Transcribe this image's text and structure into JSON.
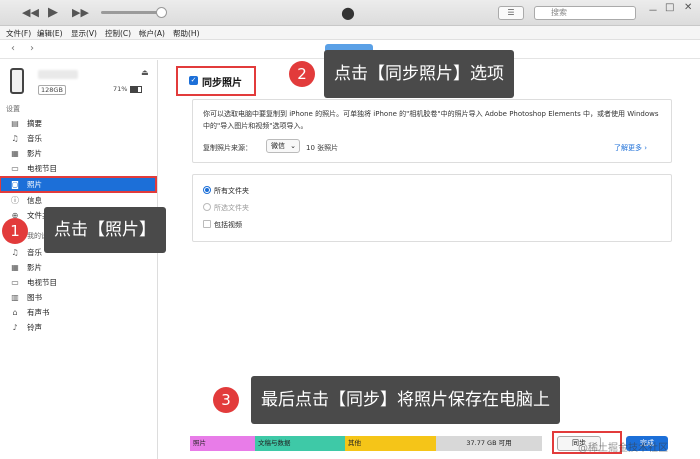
{
  "window": {
    "search_placeholder": "搜索",
    "controls": {
      "minimize": "－",
      "maximize": "□",
      "close": "✕"
    }
  },
  "menu": [
    "文件(F)",
    "编辑(E)",
    "显示(V)",
    "控制(C)",
    "帐户(A)",
    "帮助(H)"
  ],
  "device": {
    "capacity": "128GB",
    "battery": "71%"
  },
  "sidebar": {
    "settings_header": "设置",
    "settings_items": [
      {
        "label": "摘要",
        "icon": "summary-icon"
      },
      {
        "label": "音乐",
        "icon": "music-icon"
      },
      {
        "label": "影片",
        "icon": "film-icon"
      },
      {
        "label": "电视节目",
        "icon": "tv-icon"
      },
      {
        "label": "照片",
        "icon": "camera-icon",
        "selected": true
      },
      {
        "label": "信息",
        "icon": "info-icon"
      },
      {
        "label": "文件共享",
        "icon": "file-sharing-icon"
      }
    ],
    "device_header": "我的设备上",
    "device_items": [
      {
        "label": "音乐",
        "icon": "music-icon"
      },
      {
        "label": "影片",
        "icon": "film-icon"
      },
      {
        "label": "电视节目",
        "icon": "tv-icon"
      },
      {
        "label": "图书",
        "icon": "book-icon"
      },
      {
        "label": "有声书",
        "icon": "audiobook-icon"
      },
      {
        "label": "铃声",
        "icon": "bell-icon"
      }
    ]
  },
  "main": {
    "sync_photos_label": "同步照片",
    "description": "你可以选取电脑中要复制到 iPhone 的照片。可单独将 iPhone 的\"相机胶卷\"中的照片导入 Adobe Photoshop Elements 中，或者使用 Windows 中的\"导入图片和视频\"选项导入。",
    "copy_from_label": "复制照片来源：",
    "source_value": "微信",
    "photo_count": "10 张照片",
    "learn_more": "了解更多",
    "options": {
      "all_folders": "所有文件夹",
      "selected_folders": "所选文件夹",
      "include_videos": "包括视频"
    }
  },
  "storage": {
    "segments": [
      {
        "label": "照片",
        "color": "#e87ce8"
      },
      {
        "label": "文稿与数据",
        "color": "#3ec9a7"
      },
      {
        "label": "其他",
        "color": "#f5c518"
      },
      {
        "label": "37.77 GB 可用",
        "color": "#d8d8d8"
      }
    ],
    "sync_label": "同步",
    "done_label": "完成"
  },
  "callouts": {
    "step1": {
      "number": "1",
      "text": "点击【照片】"
    },
    "step2": {
      "number": "2",
      "text": "点击【同步照片】选项"
    },
    "step3": {
      "number": "3",
      "text": "最后点击【同步】将照片保存在电脑上"
    }
  },
  "watermark": "@稀土掘金技术社区",
  "colors": {
    "accent": "#1c6fd8",
    "highlight": "#e23b3b",
    "callout_bg": "#4a4a4a"
  }
}
